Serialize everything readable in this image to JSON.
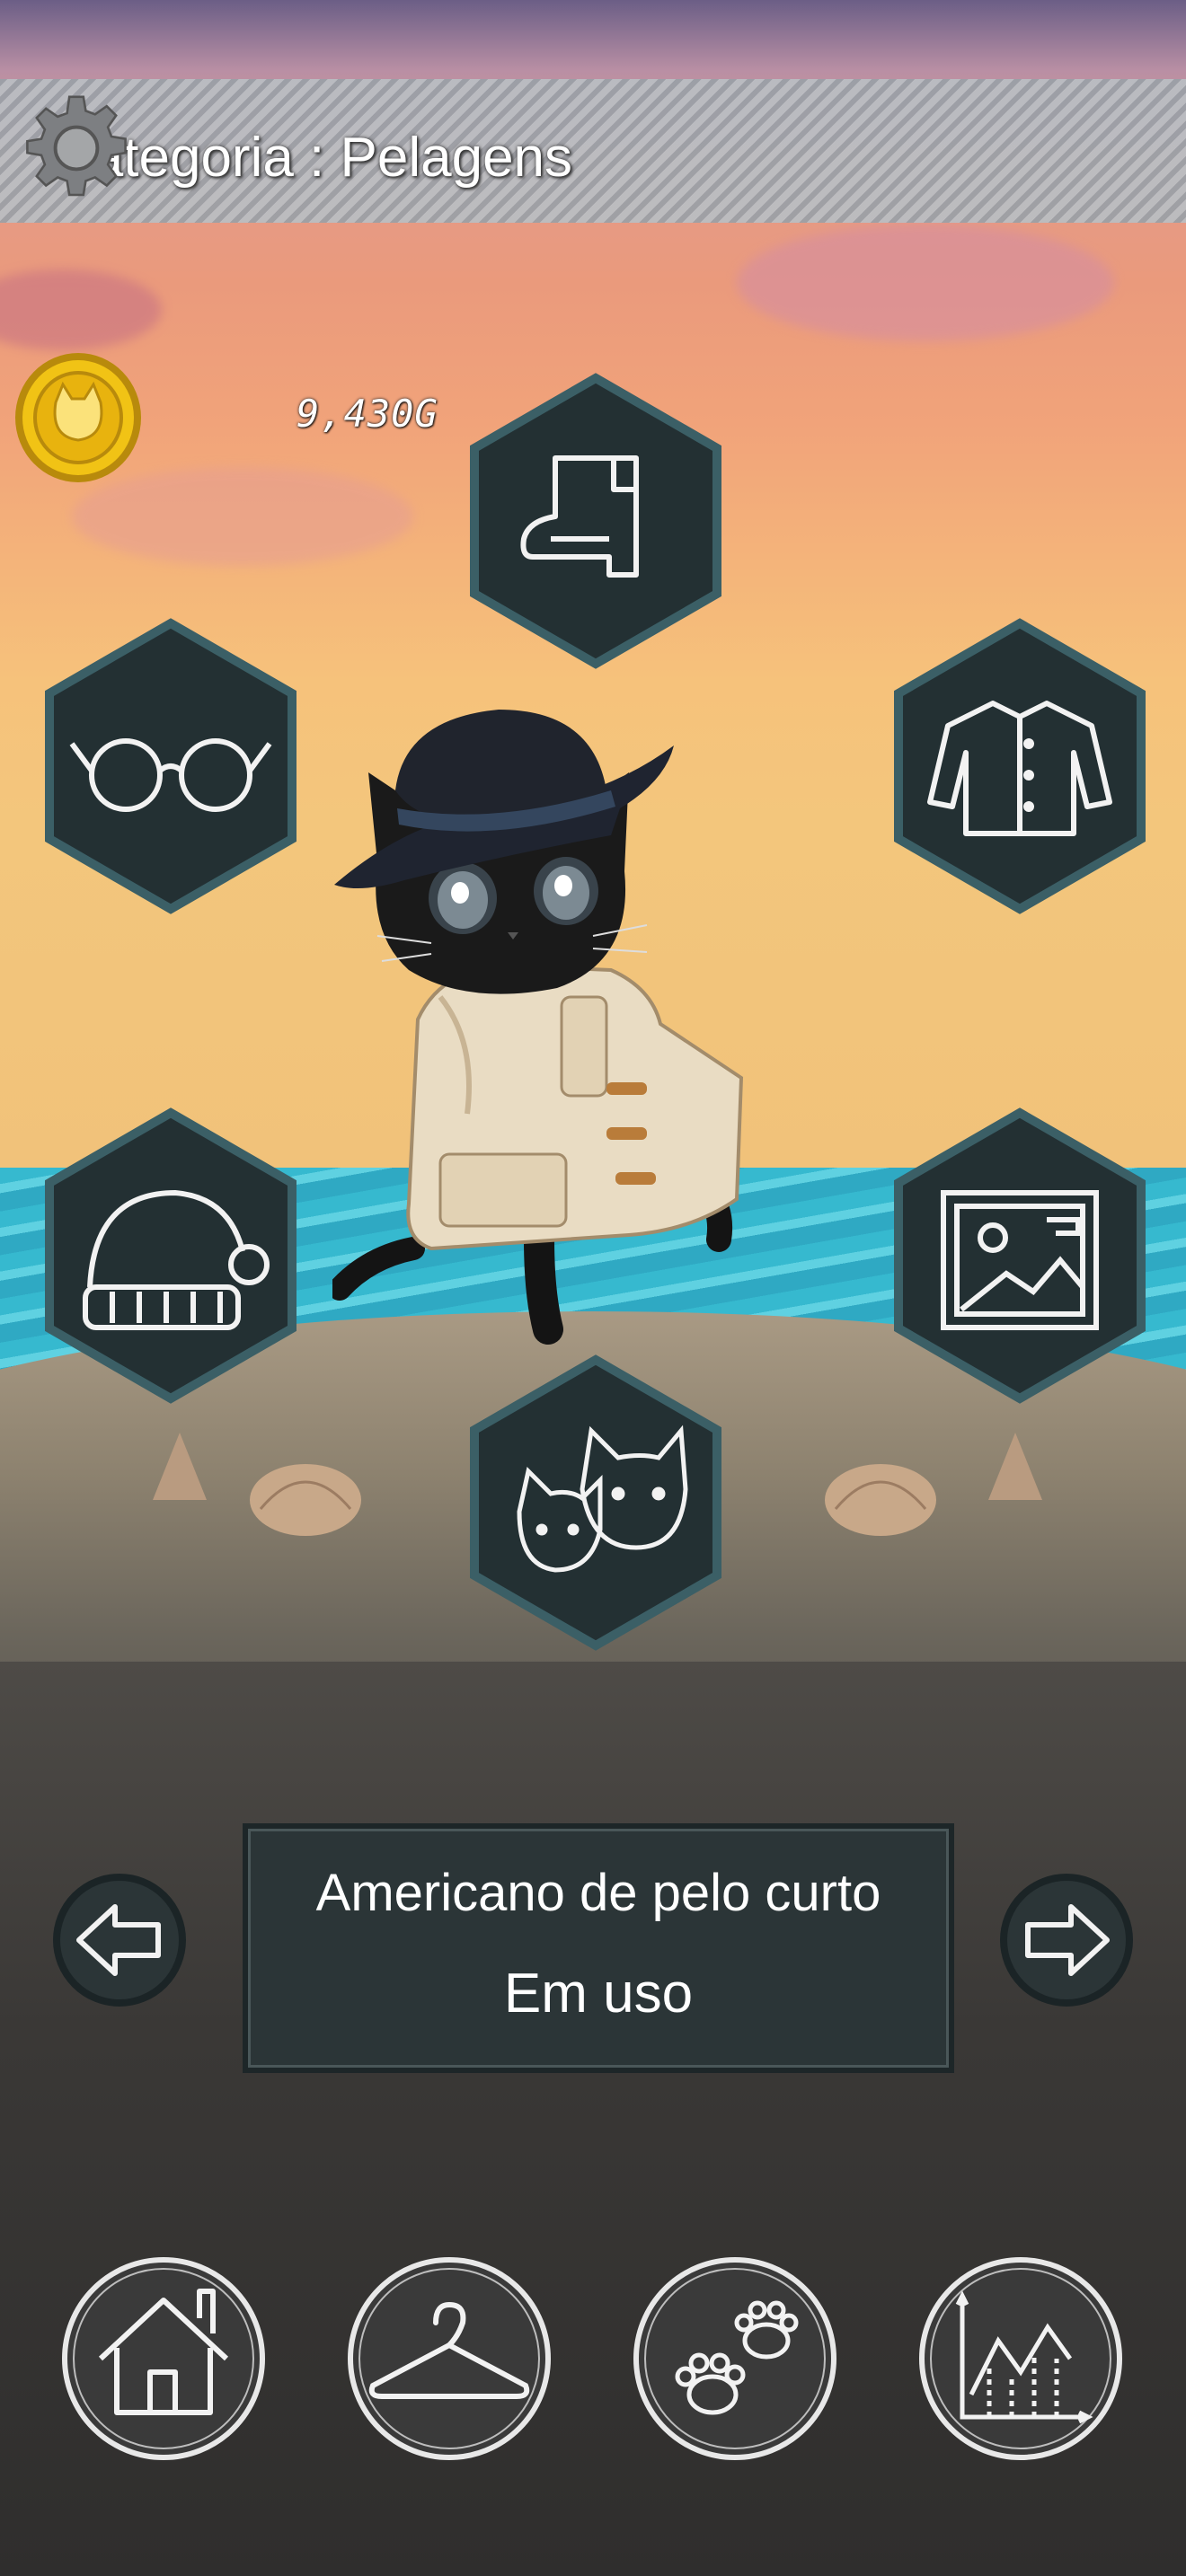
{
  "header": {
    "title": "Categoria : Pelagens",
    "settings_icon": "gear-icon"
  },
  "currency": {
    "amount": "9,430G",
    "icon": "cat-coin-icon"
  },
  "categories": [
    {
      "name": "shoes-category",
      "icon": "boot-icon"
    },
    {
      "name": "glasses-category",
      "icon": "glasses-icon"
    },
    {
      "name": "clothing-category",
      "icon": "shirt-icon"
    },
    {
      "name": "hat-category",
      "icon": "beanie-icon"
    },
    {
      "name": "background-category",
      "icon": "picture-icon"
    },
    {
      "name": "fur-category",
      "icon": "cats-icon"
    }
  ],
  "item_info": {
    "name": "Americano de pelo curto",
    "status": "Em uso"
  },
  "bottom_nav": [
    {
      "name": "home",
      "icon": "house-icon"
    },
    {
      "name": "wardrobe",
      "icon": "hanger-icon"
    },
    {
      "name": "pets",
      "icon": "paw-icon"
    },
    {
      "name": "stats",
      "icon": "chart-icon"
    }
  ],
  "colors": {
    "tile": "#233033",
    "tile_border": "#3b5f66",
    "chalk": "#f2f2f2"
  }
}
